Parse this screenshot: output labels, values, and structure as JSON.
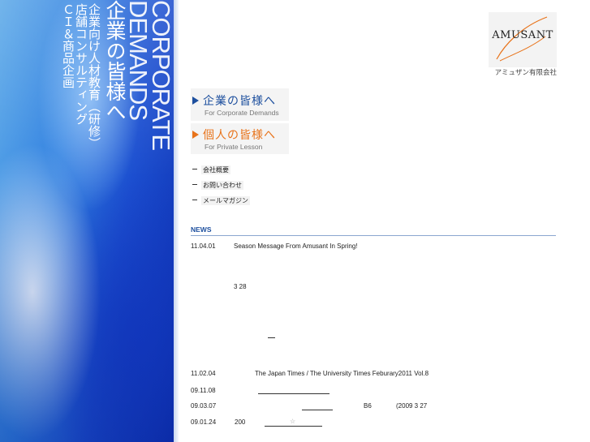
{
  "hero": {
    "corporate": "CORPORATE",
    "demands": "DEMANDS",
    "title_jp": "企業の皆様へ",
    "services": [
      "企業向け人材教育（研修）",
      "店舗コンサルティング",
      "ＣＩ＆商品企画"
    ]
  },
  "logo": {
    "name": "AMUSANT",
    "company": "アミュザン有限会社"
  },
  "nav": {
    "corporate": {
      "title": "企業の皆様へ",
      "sub": "For Corporate Demands"
    },
    "private": {
      "title": "個人の皆様へ",
      "sub": "For Private Lesson"
    }
  },
  "links": [
    "会社概要",
    "お問い合わせ",
    "メールマガジン"
  ],
  "news": {
    "heading": "NEWS",
    "items": [
      {
        "date": "11.04.01",
        "text": "Season  Message From  Amusant In Spring!",
        "extra": "3 28"
      },
      {
        "date": "11.02.04",
        "text": "The Japan Times / The University Times Feburary2011 Vol.8"
      },
      {
        "date": "09.11.08",
        "text": ""
      },
      {
        "date": "09.03.07",
        "text": "B6",
        "text2": "(2009  3 27"
      },
      {
        "date": "09.01.24",
        "text": "200",
        "star": "☆"
      }
    ]
  },
  "colors": {
    "accent_blue": "#1d4f9e",
    "accent_orange": "#e8731a"
  }
}
